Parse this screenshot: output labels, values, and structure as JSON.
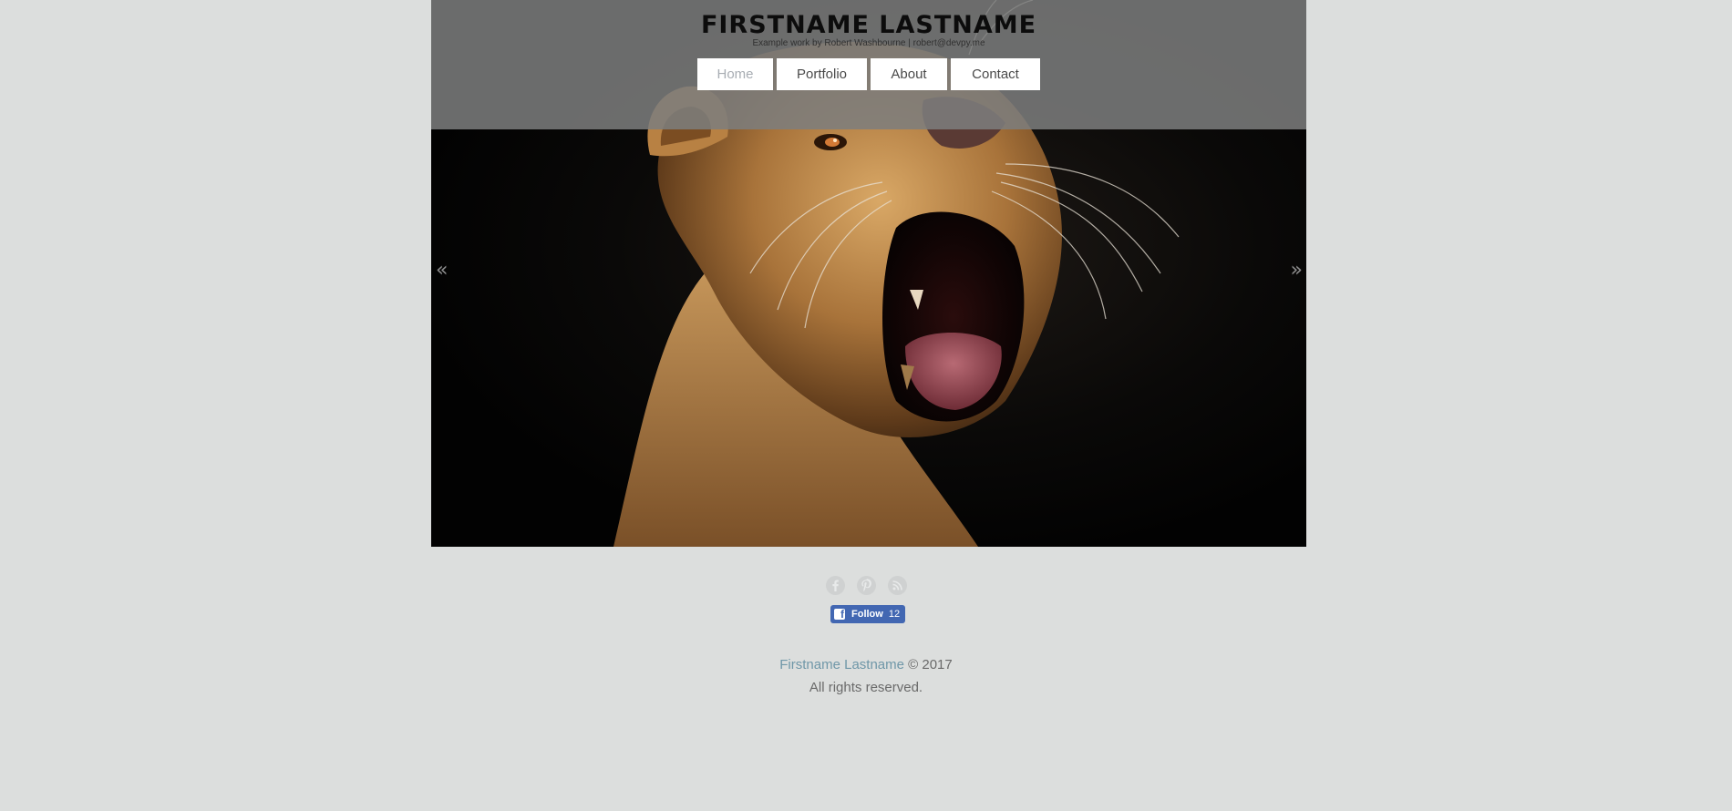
{
  "header": {
    "title": "FIRSTNAME LASTNAME",
    "subtitle": "Example work by Robert Washbourne | robert@devpy.me"
  },
  "nav": {
    "items": [
      {
        "label": "Home",
        "active": true
      },
      {
        "label": "Portfolio",
        "active": false
      },
      {
        "label": "About",
        "active": false
      },
      {
        "label": "Contact",
        "active": false
      }
    ]
  },
  "slider": {
    "prev_label": "«",
    "next_label": "»",
    "image": "lioness-roaring"
  },
  "social": {
    "icons": [
      "facebook-icon",
      "pinterest-icon",
      "rss-icon"
    ],
    "follow_button": {
      "label": "Follow",
      "count": "12",
      "color": "#4267b2"
    }
  },
  "footer": {
    "name_link": "Firstname Lastname",
    "copyright": "© 2017",
    "rights": "All rights reserved."
  },
  "colors": {
    "background": "#dcdedd",
    "header_overlay": "#7d7e7e",
    "link": "#6f97a8",
    "active_nav": "#a8adb3"
  }
}
